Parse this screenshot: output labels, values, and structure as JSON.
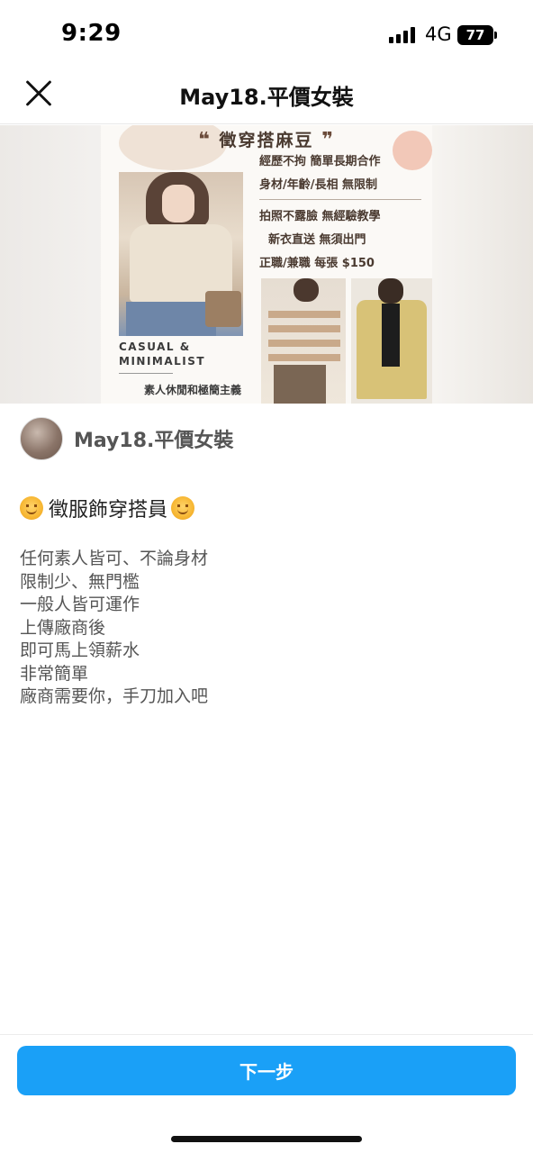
{
  "status_bar": {
    "time": "9:29",
    "network": "4G",
    "battery": "77"
  },
  "header": {
    "title": "May18.平價女裝",
    "close_icon": "close-icon"
  },
  "cover": {
    "headline": "徵穿搭麻豆",
    "quote_open": "❝",
    "quote_close": "❞",
    "lines_top": [
      "經歷不拘  簡單長期合作",
      "身材/年齡/長相  無限制"
    ],
    "lines_bottom": [
      "拍照不露臉  無經驗教學",
      "新衣直送  無須出門",
      "正職/兼職   每張 $150"
    ],
    "casual_line1": "CASUAL &",
    "casual_line2": "MINIMALIST",
    "casual_sub": "素人休閒和極簡主義"
  },
  "profile": {
    "name": "May18.平價女裝"
  },
  "post": {
    "title": "徵服飾穿搭員",
    "title_icon": "sun-emoji-icon",
    "lines": [
      "任何素人皆可、不論身材",
      "限制少、無門檻",
      "一般人皆可運作",
      "上傳廠商後",
      "即可馬上領薪水",
      "非常簡單",
      "廠商需要你，手刀加入吧"
    ]
  },
  "footer": {
    "next_label": "下一步",
    "accent_color": "#1aa0f7"
  }
}
